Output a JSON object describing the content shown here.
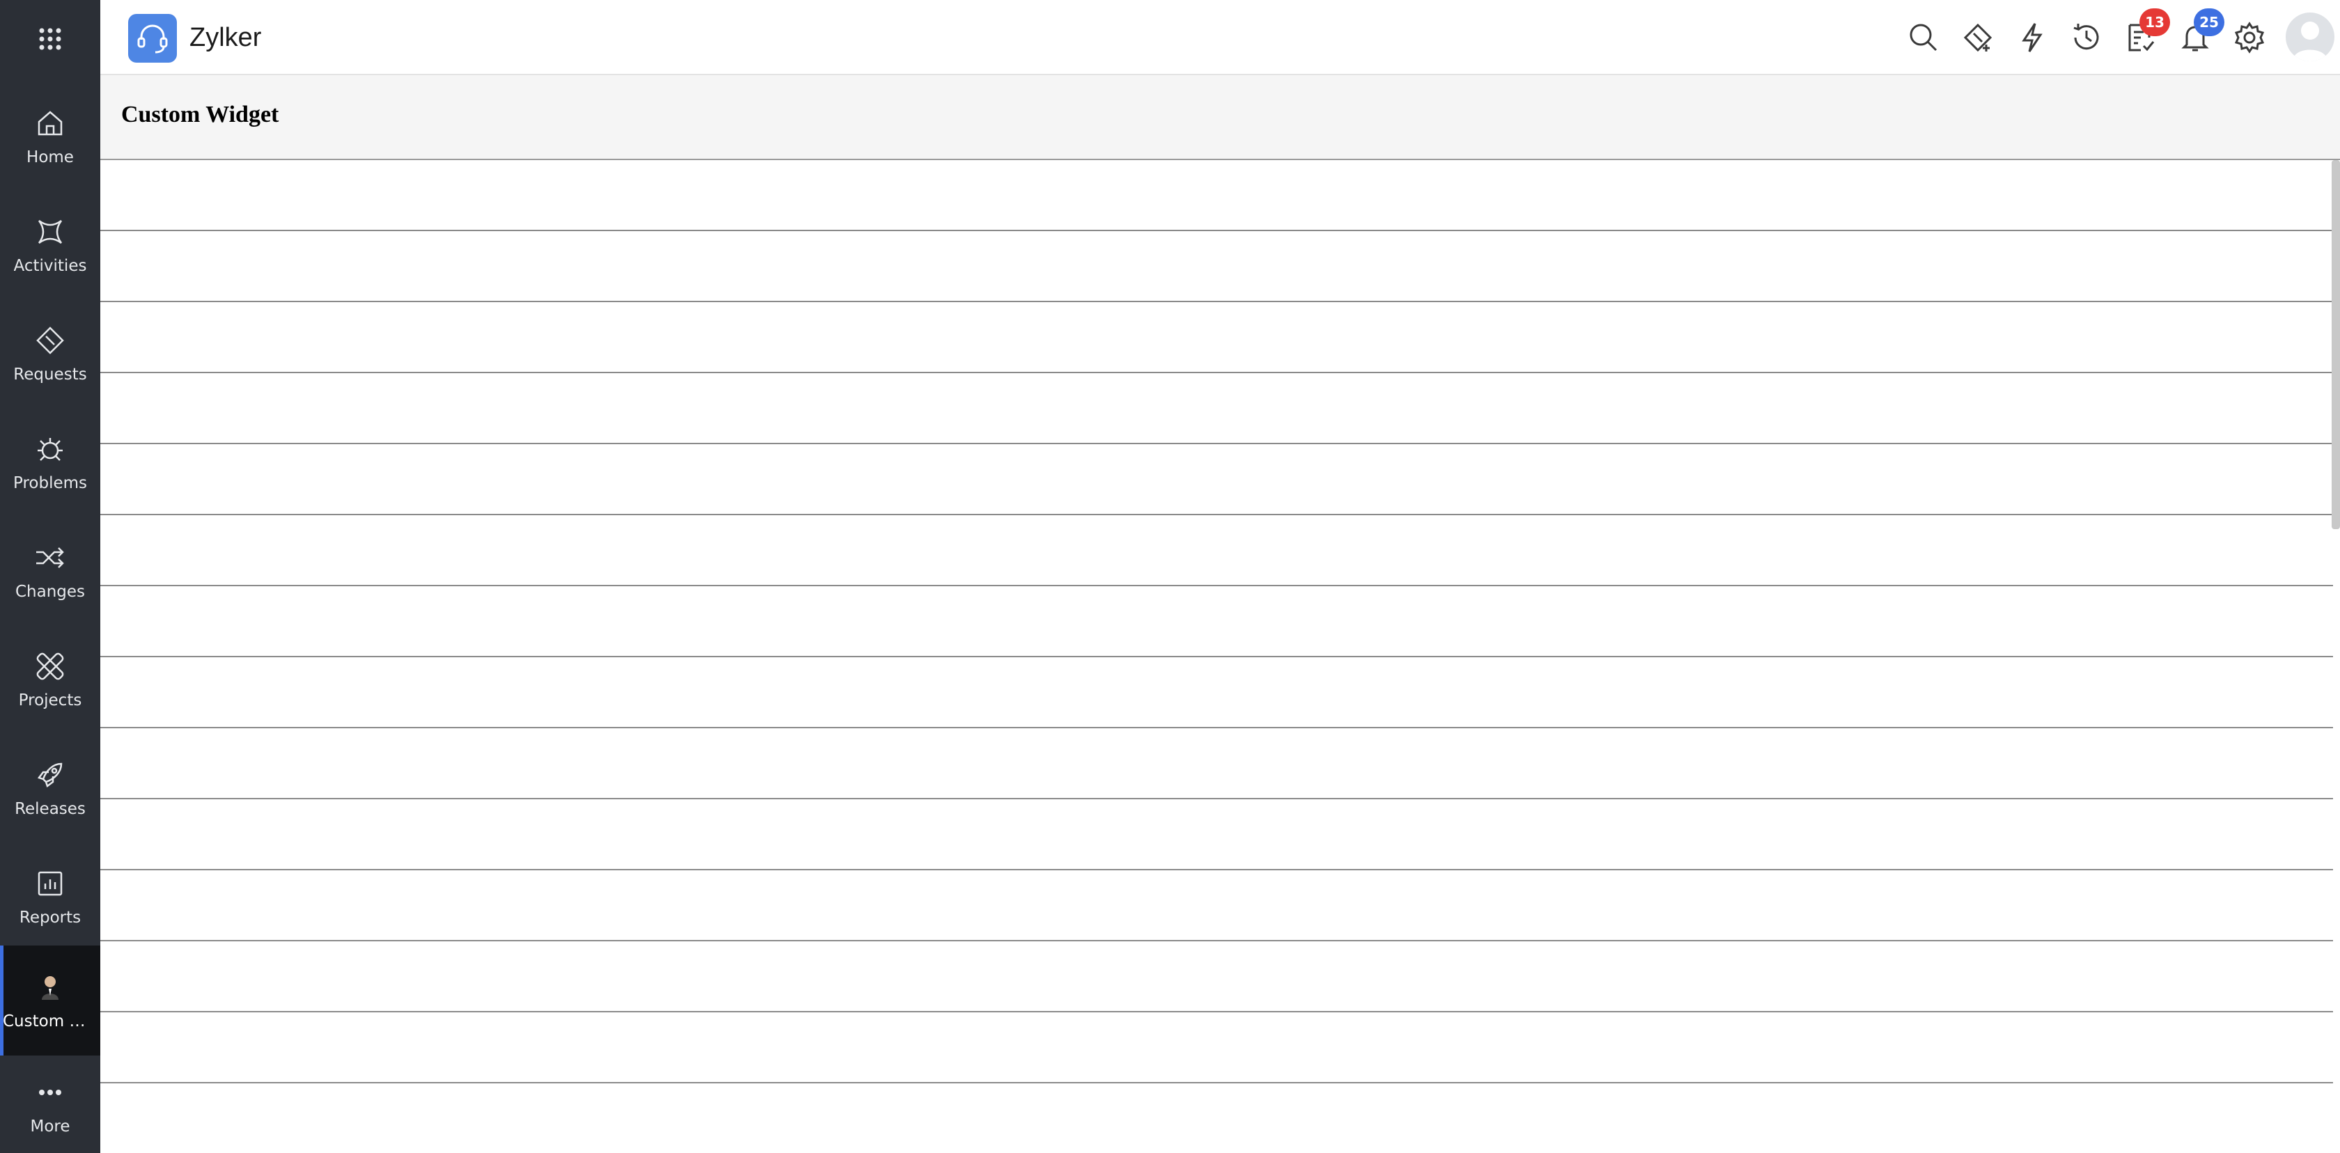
{
  "app": {
    "name": "Zylker"
  },
  "sidebar": {
    "items": [
      {
        "label": "Home"
      },
      {
        "label": "Activities"
      },
      {
        "label": "Requests"
      },
      {
        "label": "Problems"
      },
      {
        "label": "Changes"
      },
      {
        "label": "Projects"
      },
      {
        "label": "Releases"
      },
      {
        "label": "Reports"
      },
      {
        "label": "Custom Wi..."
      },
      {
        "label": "More"
      }
    ]
  },
  "header": {
    "badges": {
      "tasks": "13",
      "notifications": "25"
    },
    "colors": {
      "tasks_badge": "#e53935",
      "notifications_badge": "#3d6fe1"
    }
  },
  "page": {
    "title": "Custom Widget"
  },
  "colors": {
    "sidebar": "#2b2f36",
    "accent": "#3d6fe1",
    "logo": "#4e86e4"
  }
}
